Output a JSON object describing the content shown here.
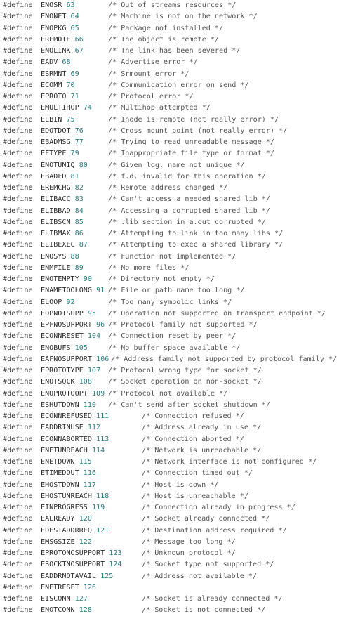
{
  "keyword": "#define",
  "lines": [
    {
      "name": "ENOSR",
      "num": "63",
      "comment": "/* Out of streams resources */",
      "tier": 1
    },
    {
      "name": "ENONET",
      "num": "64",
      "comment": "/* Machine is not on the network */",
      "tier": 1
    },
    {
      "name": "ENOPKG",
      "num": "65",
      "comment": "/* Package not installed */",
      "tier": 1
    },
    {
      "name": "EREMOTE",
      "num": "66",
      "comment": "/* The object is remote */",
      "tier": 1
    },
    {
      "name": "ENOLINK",
      "num": "67",
      "comment": "/* The link has been severed */",
      "tier": 1
    },
    {
      "name": "EADV",
      "num": "68",
      "comment": "/* Advertise error */",
      "tier": 1
    },
    {
      "name": "ESRMNT",
      "num": "69",
      "comment": "/* Srmount error */",
      "tier": 1
    },
    {
      "name": "ECOMM",
      "num": "70",
      "comment": "/* Communication error on send */",
      "tier": 1
    },
    {
      "name": "EPROTO",
      "num": "71",
      "comment": "/* Protocol error */",
      "tier": 1
    },
    {
      "name": "EMULTIHOP",
      "num": "74",
      "comment": "/* Multihop attempted */",
      "tier": 1
    },
    {
      "name": "ELBIN",
      "num": "75",
      "comment": "/* Inode is remote (not really error) */",
      "tier": 1
    },
    {
      "name": "EDOTDOT",
      "num": "76",
      "comment": "/* Cross mount point (not really error) */",
      "tier": 1
    },
    {
      "name": "EBADMSG",
      "num": "77",
      "comment": "/* Trying to read unreadable message */",
      "tier": 1
    },
    {
      "name": "EFTYPE",
      "num": "79",
      "comment": "/* Inappropriate file type or format */",
      "tier": 1
    },
    {
      "name": "ENOTUNIQ",
      "num": "80",
      "comment": "/* Given log. name not unique */",
      "tier": 1
    },
    {
      "name": "EBADFD",
      "num": "81",
      "comment": "/* f.d. invalid for this operation */",
      "tier": 1
    },
    {
      "name": "EREMCHG",
      "num": "82",
      "comment": "/* Remote address changed */",
      "tier": 1
    },
    {
      "name": "ELIBACC",
      "num": "83",
      "comment": "/* Can't access a needed shared lib */",
      "tier": 1
    },
    {
      "name": "ELIBBAD",
      "num": "84",
      "comment": "/* Accessing a corrupted shared lib */",
      "tier": 1
    },
    {
      "name": "ELIBSCN",
      "num": "85",
      "comment": "/* .lib section in a.out corrupted */",
      "tier": 1
    },
    {
      "name": "ELIBMAX",
      "num": "86",
      "comment": "/* Attempting to link in too many libs */",
      "tier": 1
    },
    {
      "name": "ELIBEXEC",
      "num": "87",
      "comment": "/* Attempting to exec a shared library */",
      "tier": 1
    },
    {
      "name": "ENOSYS",
      "num": "88",
      "comment": "/* Function not implemented */",
      "tier": 1
    },
    {
      "name": "ENMFILE",
      "num": "89",
      "comment": "/* No more files */",
      "tier": 1
    },
    {
      "name": "ENOTEMPTY",
      "num": "90",
      "comment": "/* Directory not empty */",
      "tier": 1
    },
    {
      "name": "ENAMETOOLONG",
      "num": "91",
      "comment": "/* File or path name too long */",
      "tier": 1
    },
    {
      "name": "ELOOP",
      "num": "92",
      "comment": "/* Too many symbolic links */",
      "tier": 1
    },
    {
      "name": "EOPNOTSUPP",
      "num": "95",
      "comment": "/* Operation not supported on transport endpoint */",
      "tier": 1
    },
    {
      "name": "EPFNOSUPPORT",
      "num": "96",
      "comment": "/* Protocol family not supported */",
      "tier": 1
    },
    {
      "name": "ECONNRESET",
      "num": "104",
      "comment": "/* Connection reset by peer */",
      "tier": 1
    },
    {
      "name": "ENOBUFS",
      "num": "105",
      "comment": "/* No buffer space available */",
      "tier": 1
    },
    {
      "name": "EAFNOSUPPORT",
      "num": "106",
      "comment": "/* Address family not supported by protocol family */",
      "tier": 0
    },
    {
      "name": "EPROTOTYPE",
      "num": "107",
      "comment": "/* Protocol wrong type for socket */",
      "tier": 1
    },
    {
      "name": "ENOTSOCK",
      "num": "108",
      "comment": "/* Socket operation on non-socket */",
      "tier": 1
    },
    {
      "name": "ENOPROTOOPT",
      "num": "109",
      "comment": "/* Protocol not available */",
      "tier": 1
    },
    {
      "name": "ESHUTDOWN",
      "num": "110",
      "comment": "/* Can't send after socket shutdown */",
      "tier": 1
    },
    {
      "name": "ECONNREFUSED",
      "num": "111",
      "comment": "/* Connection refused */",
      "tier": 2
    },
    {
      "name": "EADDRINUSE",
      "num": "112",
      "comment": "/* Address already in use */",
      "tier": 2
    },
    {
      "name": "ECONNABORTED",
      "num": "113",
      "comment": "/* Connection aborted */",
      "tier": 2
    },
    {
      "name": "ENETUNREACH",
      "num": "114",
      "comment": "/* Network is unreachable */",
      "tier": 2
    },
    {
      "name": "ENETDOWN",
      "num": "115",
      "comment": "/* Network interface is not configured */",
      "tier": 2
    },
    {
      "name": "ETIMEDOUT",
      "num": "116",
      "comment": "/* Connection timed out */",
      "tier": 2
    },
    {
      "name": "EHOSTDOWN",
      "num": "117",
      "comment": "/* Host is down */",
      "tier": 2
    },
    {
      "name": "EHOSTUNREACH",
      "num": "118",
      "comment": "/* Host is unreachable */",
      "tier": 2
    },
    {
      "name": "EINPROGRESS",
      "num": "119",
      "comment": "/* Connection already in progress */",
      "tier": 2
    },
    {
      "name": "EALREADY",
      "num": "120",
      "comment": "/* Socket already connected */",
      "tier": 2
    },
    {
      "name": "EDESTADDRREQ",
      "num": "121",
      "comment": "/* Destination address required */",
      "tier": 2
    },
    {
      "name": "EMSGSIZE",
      "num": "122",
      "comment": "/* Message too long */",
      "tier": 2
    },
    {
      "name": "EPROTONOSUPPORT",
      "num": "123",
      "comment": "/* Unknown protocol */",
      "tier": 2
    },
    {
      "name": "ESOCKTNOSUPPORT",
      "num": "124",
      "comment": "/* Socket type not supported */",
      "tier": 2
    },
    {
      "name": "EADDRNOTAVAIL",
      "num": "125",
      "comment": "/* Address not available */",
      "tier": 2
    },
    {
      "name": "ENETRESET",
      "num": "126",
      "comment": "",
      "tier": 2
    },
    {
      "name": "EISCONN",
      "num": "127",
      "comment": "/* Socket is already connected */",
      "tier": 2
    },
    {
      "name": "ENOTCONN",
      "num": "128",
      "comment": "/* Socket is not connected */",
      "tier": 2
    }
  ],
  "colors": {
    "background": "#ffffff",
    "text": "#2f2f2f",
    "number": "#2e7f7f",
    "comment": "#555555"
  }
}
